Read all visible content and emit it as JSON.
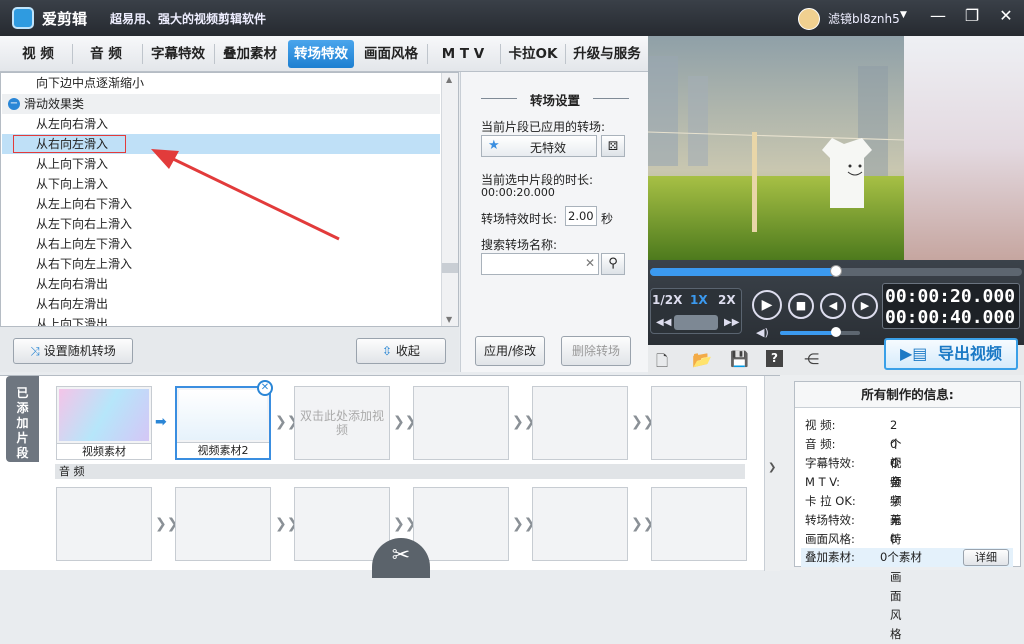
{
  "app": {
    "name": "爱剪辑",
    "slogan": "超易用、强大的视频剪辑软件",
    "user": "滤镜bl8znh5"
  },
  "tabs": [
    "视  频",
    "音  频",
    "字幕特效",
    "叠加素材",
    "转场特效",
    "画面风格",
    "M T V",
    "卡拉OK",
    "升级与服务"
  ],
  "active_tab": "转场特效",
  "effects": {
    "items": [
      {
        "label": "向下边中点逐渐缩小",
        "kind": "item"
      },
      {
        "label": "滑动效果类",
        "kind": "category"
      },
      {
        "label": "从左向右滑入",
        "kind": "item"
      },
      {
        "label": "从右向左滑入",
        "kind": "selected"
      },
      {
        "label": "从上向下滑入",
        "kind": "item"
      },
      {
        "label": "从下向上滑入",
        "kind": "item"
      },
      {
        "label": "从左上向右下滑入",
        "kind": "item"
      },
      {
        "label": "从左下向右上滑入",
        "kind": "item"
      },
      {
        "label": "从右上向左下滑入",
        "kind": "item"
      },
      {
        "label": "从右下向左上滑入",
        "kind": "item"
      },
      {
        "label": "从左向右滑出",
        "kind": "item"
      },
      {
        "label": "从右向左滑出",
        "kind": "item"
      },
      {
        "label": "从上向下滑出",
        "kind": "item"
      }
    ],
    "random_button": "设置随机转场",
    "collapse_button": "收起"
  },
  "settings": {
    "title": "转场设置",
    "applied_label": "当前片段已应用的转场:",
    "applied_value": "无特效",
    "duration_label": "当前选中片段的时长:",
    "duration_value": "00:00:20.000",
    "effect_duration_label": "转场特效时长:",
    "effect_duration_value": "2.00",
    "effect_duration_unit": "秒",
    "search_label": "搜索转场名称:",
    "search_value": "",
    "apply_button": "应用/修改",
    "delete_button": "删除转场"
  },
  "player": {
    "speeds": [
      "1/2X",
      "1X",
      "2X"
    ],
    "current_speed": "1X",
    "progress": 0.5,
    "volume": 0.7,
    "time_current": "00:00:20.000",
    "time_total": "00:00:40.000",
    "export_button": "导出视频"
  },
  "timeline": {
    "side_label": "已添加片段",
    "clips": [
      "视频素材",
      "视频素材2"
    ],
    "placeholder": "双击此处添加视频",
    "audio_label": "音 频"
  },
  "info": {
    "title": "所有制作的信息:",
    "rows": [
      {
        "k": "视    频:",
        "v": "2个视频"
      },
      {
        "k": "音    频:",
        "v": "0个音频"
      },
      {
        "k": "字幕特效:",
        "v": "0个字幕"
      },
      {
        "k": "M  T  V:",
        "v": ""
      },
      {
        "k": "卡  拉 OK:",
        "v": ""
      },
      {
        "k": "转场特效:",
        "v": "无特效"
      },
      {
        "k": "画面风格:",
        "v": "0个画面风格"
      },
      {
        "k": "叠加素材:",
        "v": "0个素材"
      }
    ],
    "detail_button": "详细"
  },
  "colors": {
    "accent": "#1d7fd1",
    "selection": "#bfe0f7",
    "annotation": "#e23b3b"
  }
}
